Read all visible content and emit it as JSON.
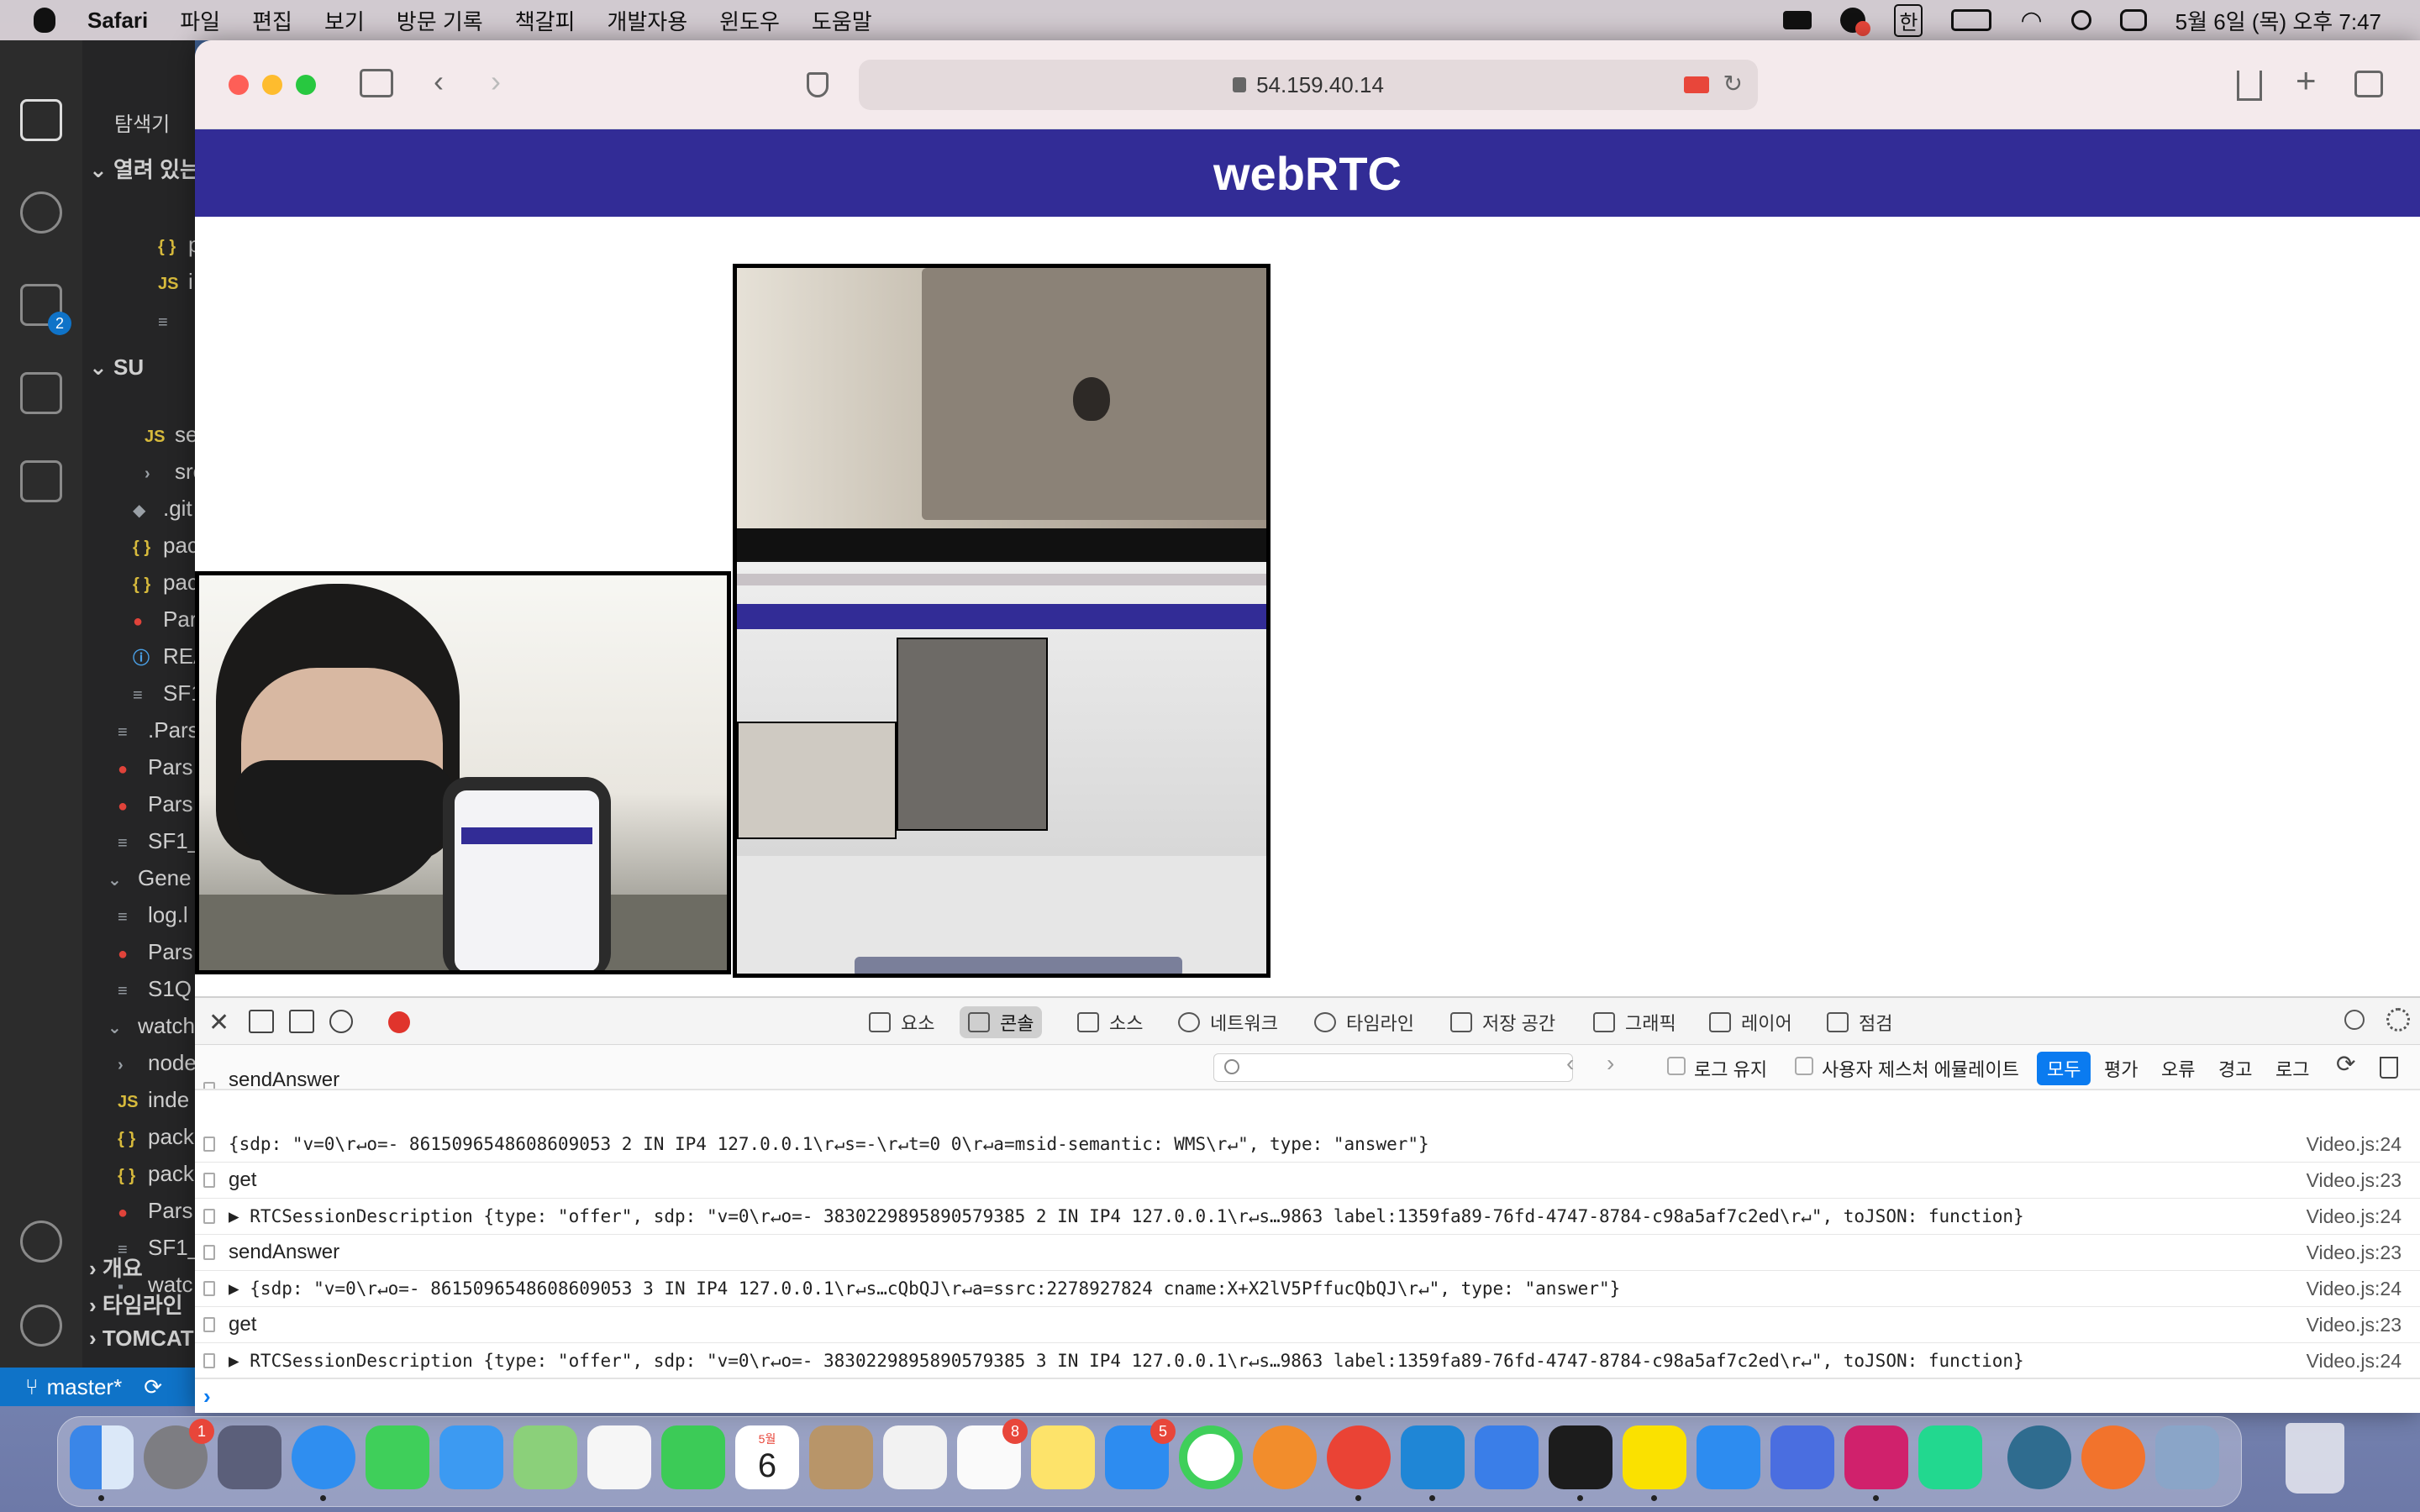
{
  "menubar": {
    "app": "Safari",
    "items": [
      "파일",
      "편집",
      "보기",
      "방문 기록",
      "책갈피",
      "개발자용",
      "윈도우",
      "도움말"
    ],
    "input_method": "한",
    "clock": "5월 6일 (목) 오후 7:47"
  },
  "vscode": {
    "explorer_title": "탐색기",
    "open_editors": "열려 있는",
    "folder": "SU",
    "tree": [
      {
        "icon": "{ }",
        "label": "p",
        "kind": "json"
      },
      {
        "icon": "JS",
        "label": "i",
        "kind": "js"
      },
      {
        "icon": "≡",
        "label": "",
        "kind": "txt"
      },
      {
        "icon": "JS",
        "label": "se",
        "kind": "js"
      },
      {
        "icon": "›",
        "label": "src",
        "kind": "txt"
      },
      {
        "icon": "◆",
        "label": ".git",
        "kind": "txt"
      },
      {
        "icon": "{ }",
        "label": "pac",
        "kind": "json"
      },
      {
        "icon": "{ }",
        "label": "pac",
        "kind": "json"
      },
      {
        "icon": "●",
        "label": "Par",
        "kind": "red"
      },
      {
        "icon": "ⓘ",
        "label": "REA",
        "kind": "info"
      },
      {
        "icon": "≡",
        "label": "SF1",
        "kind": "txt"
      },
      {
        "icon": "≡",
        "label": ".Pars",
        "kind": "txt"
      },
      {
        "icon": "●",
        "label": "Pars",
        "kind": "red"
      },
      {
        "icon": "●",
        "label": "Pars",
        "kind": "red"
      },
      {
        "icon": "≡",
        "label": "SF1_",
        "kind": "txt"
      },
      {
        "icon": "⌄",
        "label": "Gene",
        "kind": "txt"
      },
      {
        "icon": "≡",
        "label": "log.l",
        "kind": "txt"
      },
      {
        "icon": "●",
        "label": "Pars",
        "kind": "red"
      },
      {
        "icon": "≡",
        "label": "S1Q",
        "kind": "txt"
      },
      {
        "icon": "⌄",
        "label": "watch",
        "kind": "txt"
      },
      {
        "icon": "›",
        "label": "node",
        "kind": "txt"
      },
      {
        "icon": "JS",
        "label": "inde",
        "kind": "js"
      },
      {
        "icon": "{ }",
        "label": "pack",
        "kind": "json"
      },
      {
        "icon": "{ }",
        "label": "pack",
        "kind": "json"
      },
      {
        "icon": "●",
        "label": "Pars",
        "kind": "red"
      },
      {
        "icon": "≡",
        "label": "SF1_",
        "kind": "txt"
      },
      {
        "icon": "▪",
        "label": "watc",
        "kind": "txt"
      }
    ],
    "sections": [
      "개요",
      "타임라인",
      "TOMCAT"
    ],
    "scm_badge": "2",
    "branch": "master*"
  },
  "safari": {
    "url": "54.159.40.14"
  },
  "page": {
    "title": "webRTC"
  },
  "devtools": {
    "tabs": [
      "요소",
      "콘솔",
      "소스",
      "네트워크",
      "타임라인",
      "저장 공간",
      "그래픽",
      "레이어",
      "점검"
    ],
    "selected_tab": "콘솔",
    "search_placeholder": "",
    "preserve_log": "로그 유지",
    "user_gesture": "사용자 제스처 에뮬레이트",
    "levels": [
      "모두",
      "평가",
      "오류",
      "경고",
      "로그"
    ],
    "selected_level": "모두",
    "logs": [
      {
        "text": "sendAnswer",
        "source": ""
      },
      {
        "text": "{sdp: \"v=0\\r↵o=- 8615096548608609053 2 IN IP4 127.0.0.1\\r↵s=-\\r↵t=0 0\\r↵a=msid-semantic: WMS\\r↵\", type: \"answer\"}",
        "source": "Video.js:24"
      },
      {
        "text": "get",
        "source": "Video.js:23"
      },
      {
        "text": "▶ RTCSessionDescription {type: \"offer\", sdp: \"v=0\\r↵o=- 3830229895890579385 2 IN IP4 127.0.0.1\\r↵s…9863 label:1359fa89-76fd-4747-8784-c98a5af7c2ed\\r↵\", toJSON: function}",
        "source": "Video.js:24"
      },
      {
        "text": "sendAnswer",
        "source": "Video.js:23"
      },
      {
        "text": "▶ {sdp: \"v=0\\r↵o=- 8615096548608609053 3 IN IP4 127.0.0.1\\r↵s…cQbQJ\\r↵a=ssrc:2278927824 cname:X+X2lV5PffucQbQJ\\r↵\", type: \"answer\"}",
        "source": "Video.js:24"
      },
      {
        "text": "get",
        "source": "Video.js:23"
      },
      {
        "text": "▶ RTCSessionDescription {type: \"offer\", sdp: \"v=0\\r↵o=- 3830229895890579385 3 IN IP4 127.0.0.1\\r↵s…9863 label:1359fa89-76fd-4747-8784-c98a5af7c2ed\\r↵\", toJSON: function}",
        "source": "Video.js:24"
      }
    ]
  },
  "dock": {
    "badges": {
      "system_preferences": "1",
      "reminders": "8",
      "app_store": "5"
    },
    "calendar_month": "5월",
    "calendar_day": "6"
  }
}
